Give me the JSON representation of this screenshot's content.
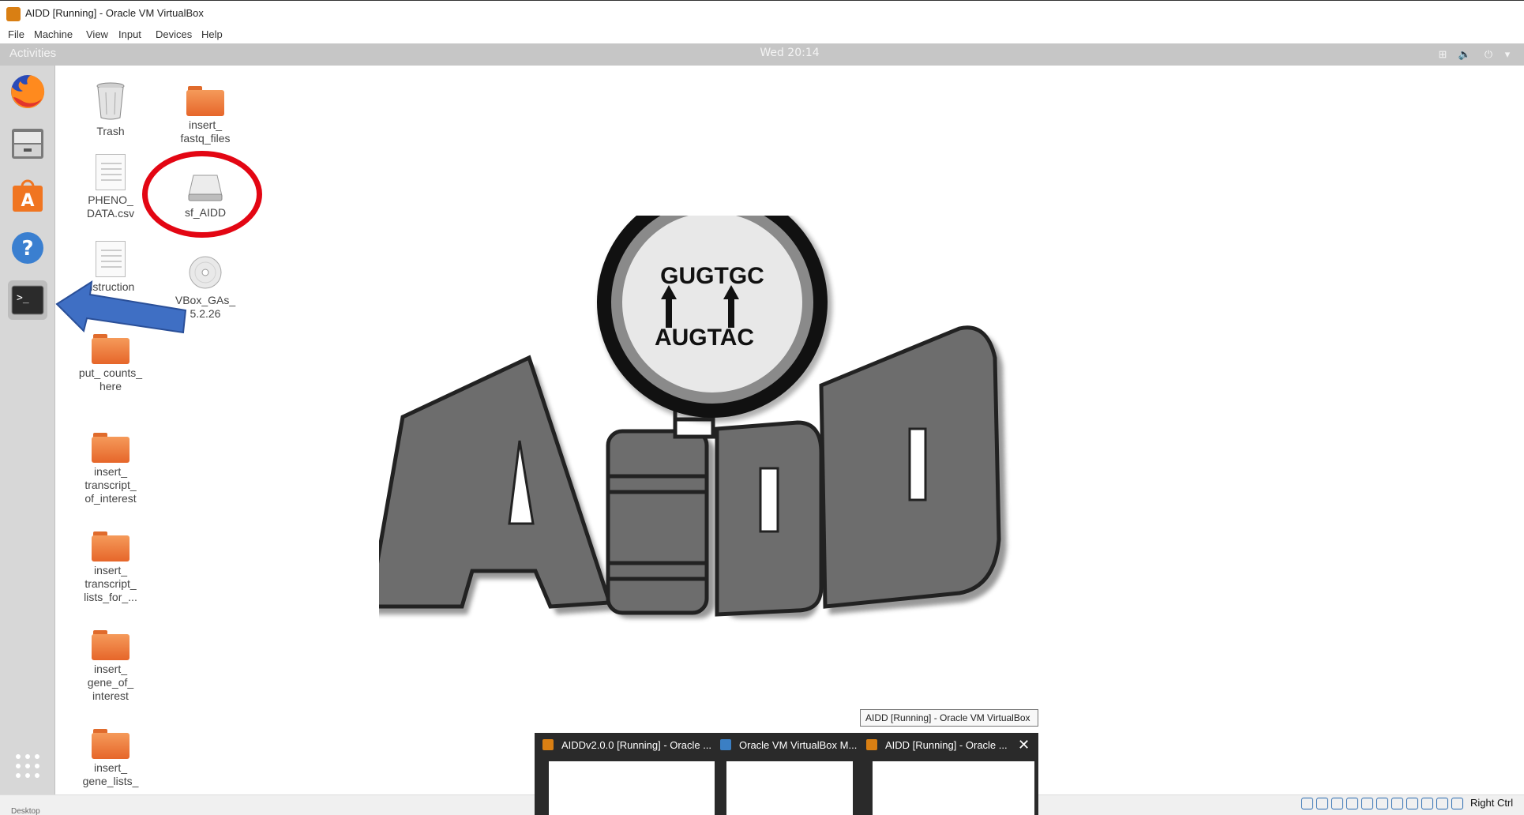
{
  "window": {
    "title": "AIDD [Running] - Oracle VM VirtualBox"
  },
  "menu": [
    "File",
    "Machine",
    "View",
    "Input",
    "Devices",
    "Help"
  ],
  "topbar": {
    "activities": "Activities",
    "clock": "Wed 20:14"
  },
  "dock": [
    {
      "name": "firefox",
      "icon": "firefox-icon"
    },
    {
      "name": "files",
      "icon": "file-cabinet-icon"
    },
    {
      "name": "software",
      "icon": "software-center-icon"
    },
    {
      "name": "help",
      "icon": "help-icon"
    },
    {
      "name": "terminal",
      "icon": "terminal-icon"
    }
  ],
  "desktop": {
    "icons": [
      {
        "label": "Trash",
        "type": "trash"
      },
      {
        "label": "insert_ fastq_files",
        "type": "folder"
      },
      {
        "label": "PHENO_ DATA.csv",
        "type": "document"
      },
      {
        "label": "sf_AIDD",
        "type": "drive"
      },
      {
        "label": "nstruction",
        "type": "document"
      },
      {
        "label": "VBox_GAs_ 5.2.26",
        "type": "disc"
      },
      {
        "label": "put_ counts_ here",
        "type": "folder"
      },
      {
        "label": "insert_ transcript_ of_interest",
        "type": "folder"
      },
      {
        "label": "insert_ transcript_ lists_for_...",
        "type": "folder"
      },
      {
        "label": "insert_ gene_of_ interest",
        "type": "folder"
      },
      {
        "label": "insert_ gene_lists_",
        "type": "folder"
      }
    ]
  },
  "logo": {
    "top_text": "GUGTGC",
    "bottom_text": "AUGTAC",
    "word": "AIDD"
  },
  "taskbar": {
    "tooltip": "AIDD [Running] - Oracle VM VirtualBox",
    "previews": [
      {
        "title": "AIDDv2.0.0 [Running] - Oracle ..."
      },
      {
        "title": "Oracle VM VirtualBox M..."
      },
      {
        "title": "AIDD [Running] - Oracle ..."
      }
    ]
  },
  "status": {
    "host_key": "Right Ctrl",
    "desktop_label": "Desktop"
  },
  "colors": {
    "annotation_circle": "#e30613",
    "annotation_arrow": "#3f6fc4",
    "folder": "#ef8040",
    "dock": "#d7d7d7"
  }
}
